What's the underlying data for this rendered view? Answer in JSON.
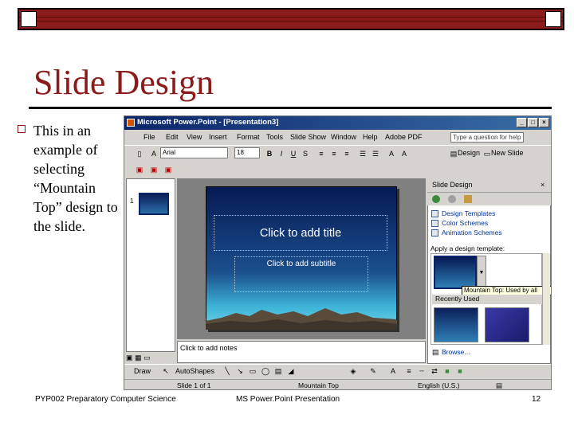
{
  "slide": {
    "title": "Slide Design",
    "body": "This in an example of selecting “Mountain Top” design to the slide."
  },
  "footer": {
    "left": "PYP002 Preparatory Computer Science",
    "center": "MS Power.Point Presentation",
    "page": "12"
  },
  "screenshot": {
    "window_title": "Microsoft Power.Point - [Presentation3]",
    "window_buttons": [
      "_",
      "□",
      "×"
    ],
    "menus": [
      "File",
      "Edit",
      "View",
      "Insert",
      "Format",
      "Tools",
      "Slide Show",
      "Window",
      "Help",
      "Adobe PDF"
    ],
    "ask_placeholder": "Type a question for help",
    "font_name": "Arial",
    "font_size": "18",
    "toolbar_buttons": [
      "B",
      "I",
      "U",
      "S"
    ],
    "design_label": "Design",
    "new_slide_label": "New Slide",
    "thumb_number": "1",
    "title_placeholder": "Click to add title",
    "subtitle_placeholder": "Click to add subtitle",
    "notes_placeholder": "Click to add notes",
    "task_pane": {
      "title": "Slide Design",
      "links": [
        "Design Templates",
        "Color Schemes",
        "Animation Schemes"
      ],
      "apply_label": "Apply a design template:",
      "tooltip": "Mountain Top: Used by all slides",
      "recently_used": "Recently Used",
      "browse": "Browse..."
    },
    "draw_label": "Draw",
    "autoshapes_label": "AutoShapes",
    "status": {
      "slide": "Slide 1 of 1",
      "design": "Mountain Top",
      "language": "English (U.S.)"
    }
  }
}
